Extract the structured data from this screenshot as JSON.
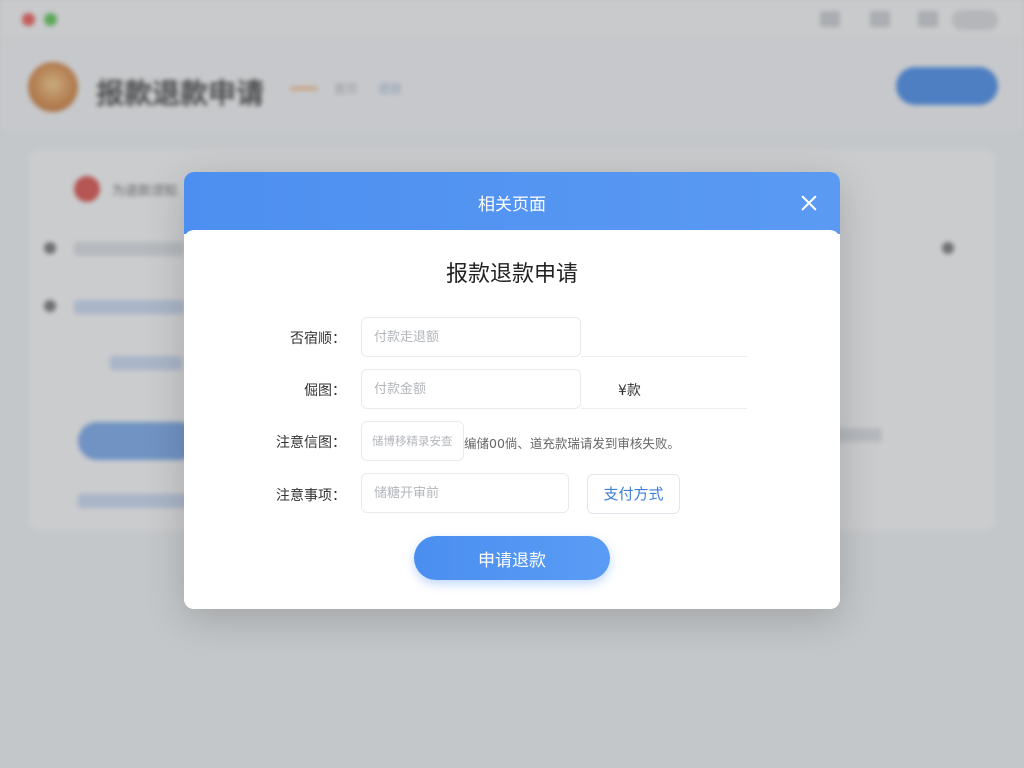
{
  "window": {
    "titlebar_text": "● ● ●"
  },
  "app": {
    "title": "报款退款申请",
    "subtitle_1": "首页",
    "subtitle_2": "退款"
  },
  "background_card": {
    "title": "为退款须知"
  },
  "modal": {
    "header_title": "相关页面",
    "form_title": "报款退款申请",
    "fields": [
      {
        "label": "否宿顺：",
        "placeholder": "付款走退额"
      },
      {
        "label": "倔图：",
        "placeholder": "付款金额",
        "suffix": "¥款"
      },
      {
        "label": "注意信图：",
        "placeholder": "储博移精录安查",
        "note": "编储00倘、道充款瑞请发到审核失败。"
      },
      {
        "label": "注意事项：",
        "placeholder": "储糖开审前"
      }
    ],
    "pay_method_label": "支付方式",
    "submit_label": "申请退款"
  },
  "colors": {
    "primary": "#4d8ff0",
    "link": "#3d7fd9",
    "overlay": "rgba(90,92,96,0.28)"
  }
}
